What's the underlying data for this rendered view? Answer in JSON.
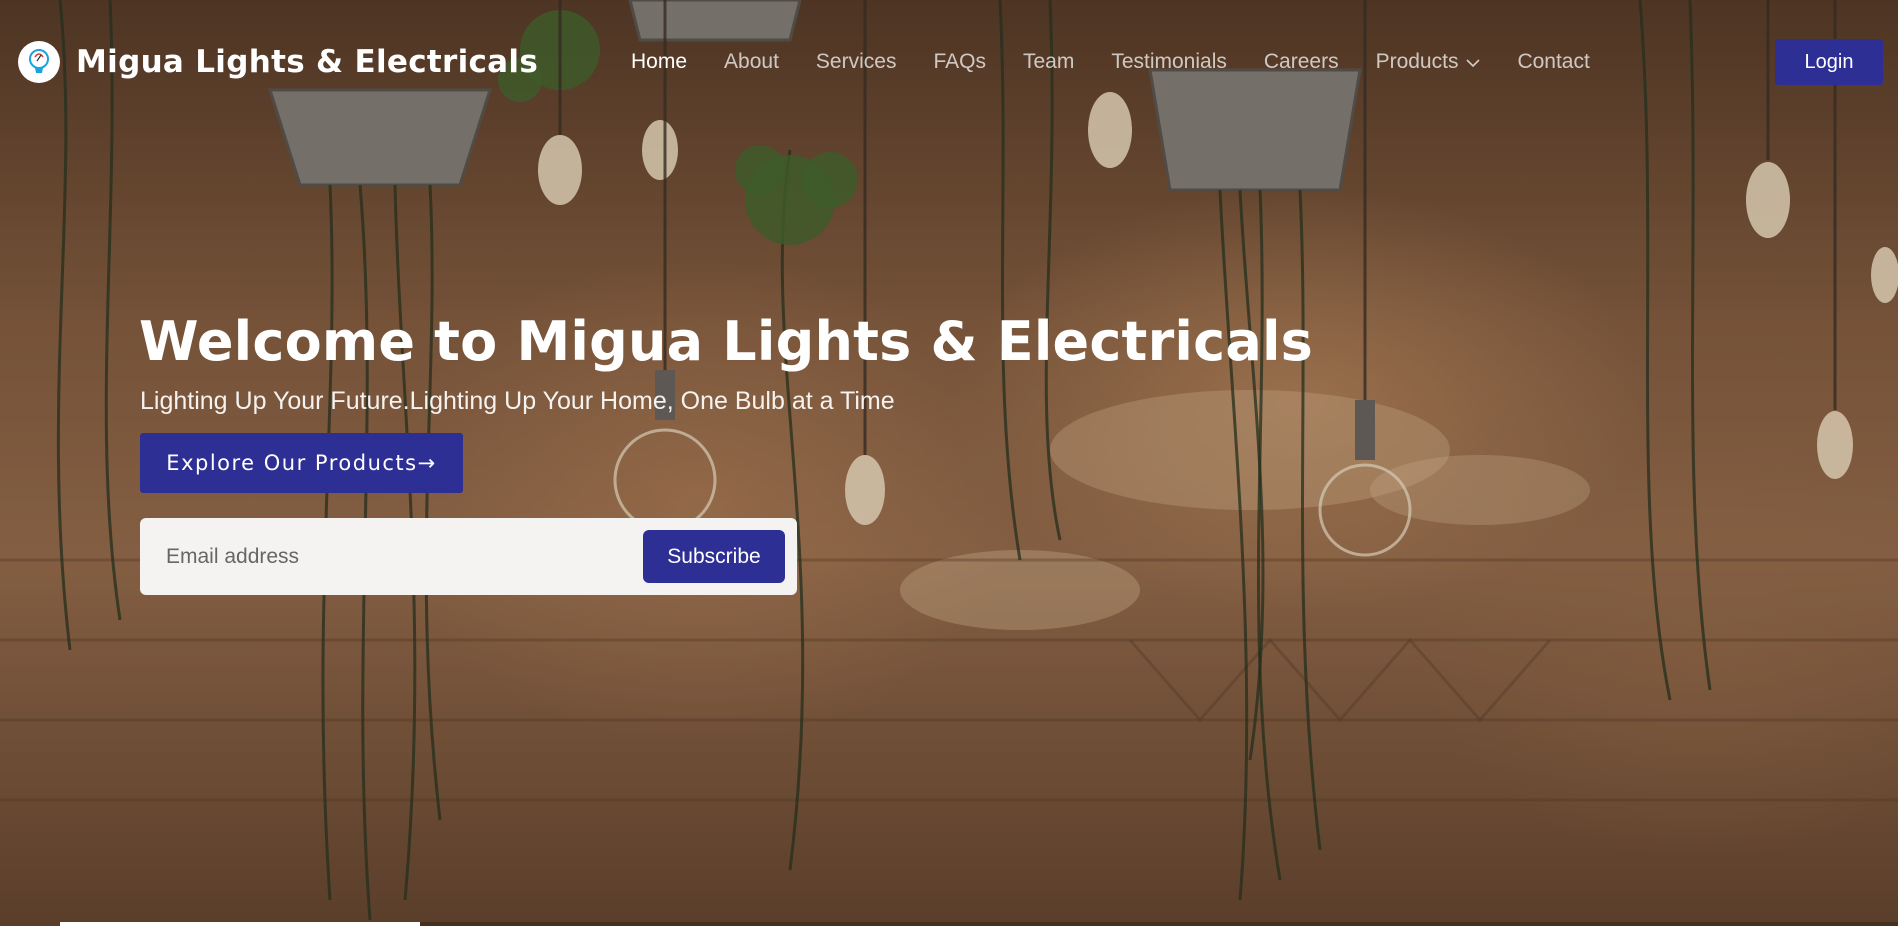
{
  "brand": {
    "name": "Migua Lights & Electricals",
    "logo_icon": "lightbulb-icon",
    "accent_color": "#2e2f94"
  },
  "nav": {
    "items": [
      {
        "label": "Home",
        "active": true
      },
      {
        "label": "About",
        "active": false
      },
      {
        "label": "Services",
        "active": false
      },
      {
        "label": "FAQs",
        "active": false
      },
      {
        "label": "Team",
        "active": false
      },
      {
        "label": "Testimonials",
        "active": false
      },
      {
        "label": "Careers",
        "active": false
      },
      {
        "label": "Products",
        "active": false,
        "icon": "chevron-down-icon"
      },
      {
        "label": "Contact",
        "active": false
      }
    ],
    "login_label": "Login"
  },
  "hero": {
    "title": "Welcome to Migua Lights & Electricals",
    "subtitle": "Lighting Up Your Future.Lighting Up Your Home, One Bulb at a Time",
    "cta_label": "Explore Our Products→",
    "email_placeholder": "Email address",
    "subscribe_label": "Subscribe",
    "background": "hanging-plants-and-bulbs-photo"
  }
}
